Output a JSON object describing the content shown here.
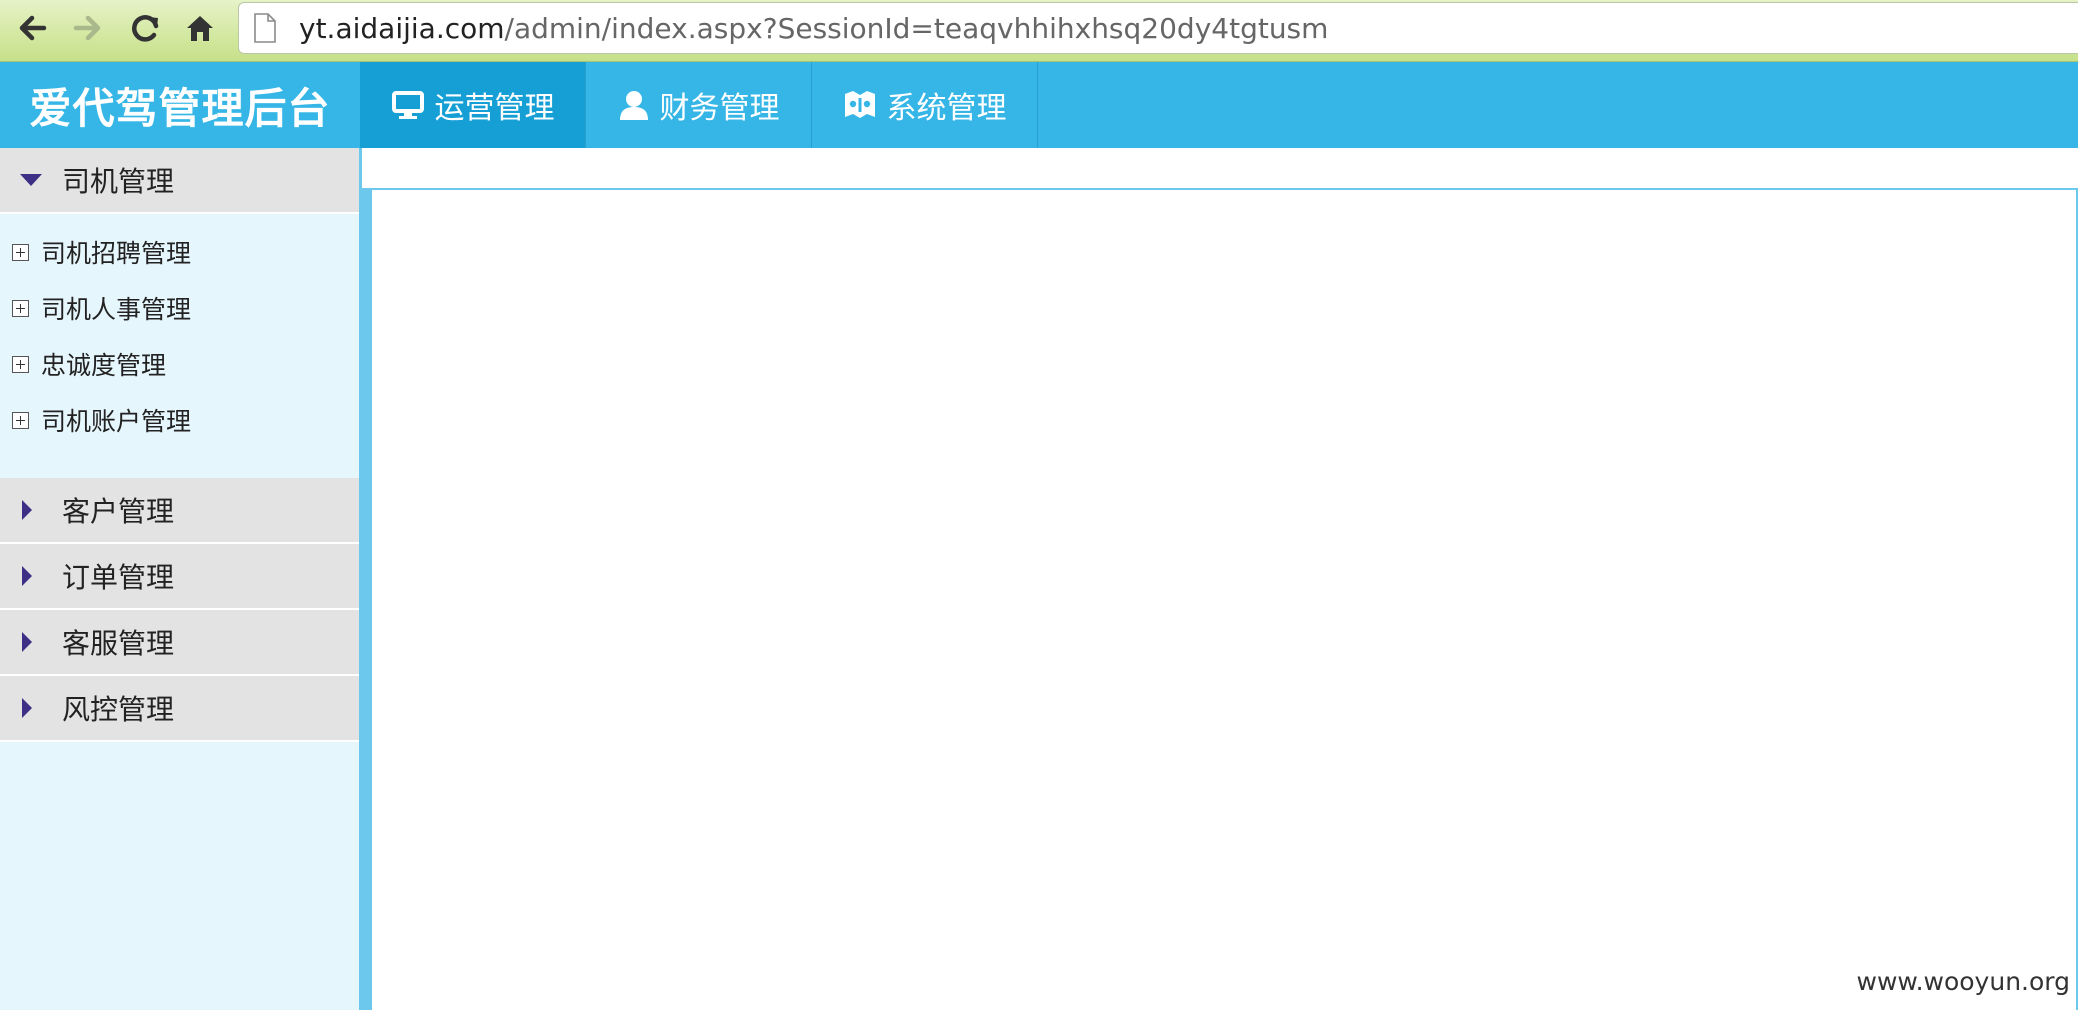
{
  "browser": {
    "back_icon": "arrow-left-icon",
    "forward_icon": "arrow-right-icon",
    "reload_icon": "reload-icon",
    "home_icon": "home-icon",
    "url_host": "yt.aidaijia.com",
    "url_path": "/admin/index.aspx?SessionId=teaqvhhihxhsq20dy4tgtusm"
  },
  "header": {
    "brand": "爱代驾管理后台",
    "tabs": [
      {
        "label": "运营管理",
        "icon": "monitor-icon",
        "active": true
      },
      {
        "label": "财务管理",
        "icon": "user-icon",
        "active": false
      },
      {
        "label": "系统管理",
        "icon": "system-icon",
        "active": false
      }
    ],
    "colors": {
      "header_bg": "#36b6e6",
      "active_tab_bg": "#159fd5"
    }
  },
  "sidebar": {
    "groups": [
      {
        "label": "司机管理",
        "expanded": true,
        "items": [
          "司机招聘管理",
          "司机人事管理",
          "忠诚度管理",
          "司机账户管理"
        ]
      },
      {
        "label": "客户管理",
        "expanded": false
      },
      {
        "label": "订单管理",
        "expanded": false
      },
      {
        "label": "客服管理",
        "expanded": false
      },
      {
        "label": "风控管理",
        "expanded": false
      }
    ],
    "colors": {
      "bg": "#e6f6fd",
      "group_header_bg": "#e3e3e3",
      "arrow": "#3d2f86"
    }
  },
  "content": {
    "watermark": "www.wooyun.org"
  }
}
